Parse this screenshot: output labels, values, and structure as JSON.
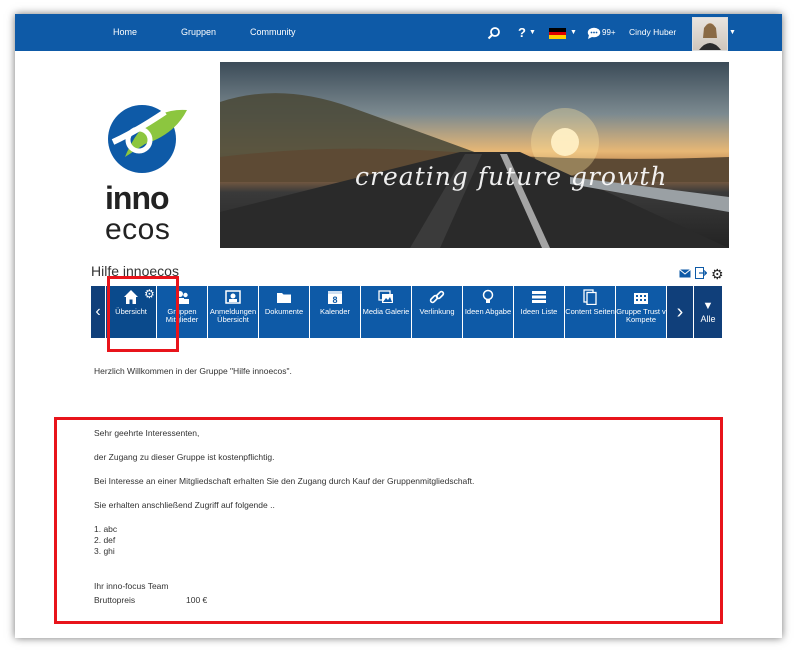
{
  "nav": {
    "home": "Home",
    "groups": "Gruppen",
    "community": "Community",
    "notifications_count": "99+",
    "user_name": "Cindy Huber"
  },
  "logo": {
    "line1": "inno",
    "line2": "ecos"
  },
  "hero": {
    "tagline": "creating future growth"
  },
  "group": {
    "title": "Hilfe innoecos"
  },
  "tabs": [
    {
      "icon": "home-icon",
      "label": "Übersicht"
    },
    {
      "icon": "users-icon",
      "label": "Gruppen Mitglieder"
    },
    {
      "icon": "registrations-icon",
      "label": "Anmeldungen Übersicht"
    },
    {
      "icon": "folder-icon",
      "label": "Dokumente"
    },
    {
      "icon": "calendar-icon",
      "label": "Kalender",
      "badge": "8"
    },
    {
      "icon": "gallery-icon",
      "label": "Media Galerie"
    },
    {
      "icon": "link-icon",
      "label": "Verlinkung"
    },
    {
      "icon": "lightbulb-icon",
      "label": "Ideen Abgabe"
    },
    {
      "icon": "list-icon",
      "label": "Ideen Liste"
    },
    {
      "icon": "pages-icon",
      "label": "Content Seiten"
    },
    {
      "icon": "building-icon",
      "label": "Gruppe Trust v Kompete"
    }
  ],
  "all_label": "Alle",
  "welcome": "Herzlich Willkommen in der Gruppe \"Hilfe innoecos\".",
  "panel": {
    "salutation": "Sehr geehrte Interessenten,",
    "line1": "der Zugang zu dieser Gruppe ist kostenpflichtig.",
    "line2": "Bei Interesse an einer Mitgliedschaft erhalten Sie den Zugang durch Kauf der Gruppenmitgliedschaft.",
    "line3": "Sie erhalten anschließend Zugriff auf folgende ..",
    "items": [
      "1. abc",
      "2. def",
      "3. ghi"
    ],
    "signature": "Ihr inno-focus Team",
    "price_label": "Bruttopreis",
    "price_value": "100 €"
  },
  "colors": {
    "accent": "#0e5aa7",
    "highlight": "#e8141b"
  }
}
